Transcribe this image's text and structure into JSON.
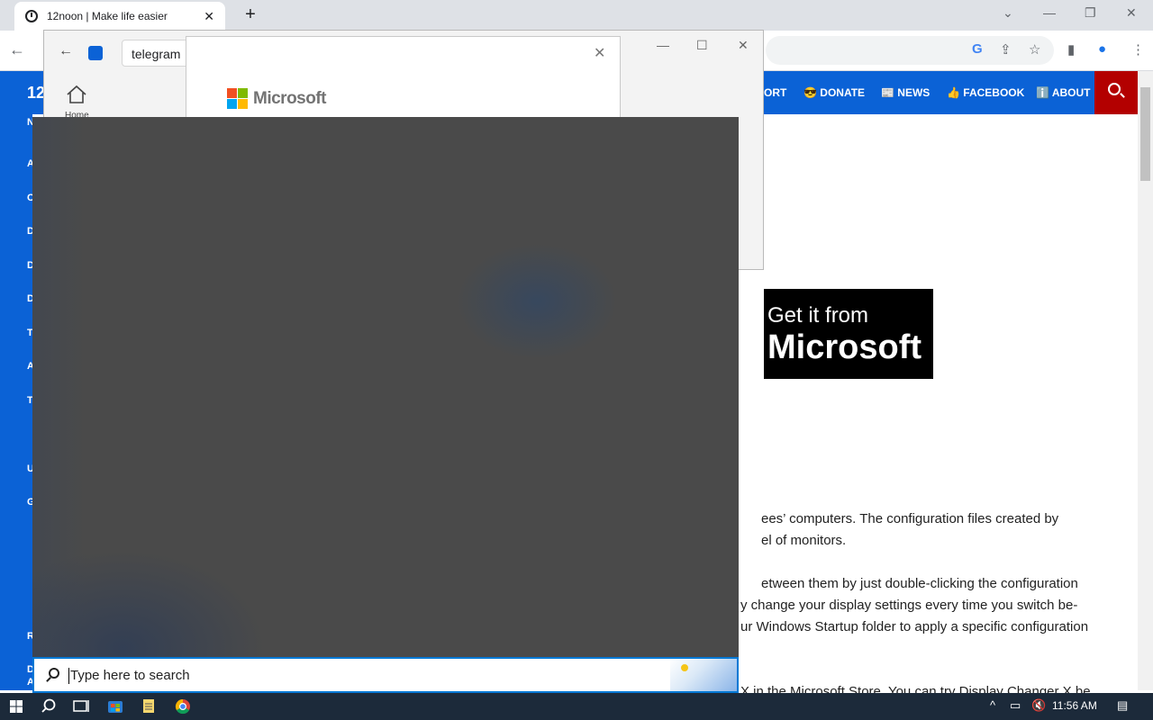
{
  "browser": {
    "tab_title": "12noon | Make life easier",
    "tab_close": "✕",
    "new_tab": "+",
    "back": "←",
    "minimize": "—",
    "restore": "❐",
    "close": "✕"
  },
  "site": {
    "logo": "12",
    "nav_items": [
      "ORT",
      "😎 DONATE",
      "📰 NEWS",
      "👍 FACEBOOK",
      "ℹ️ ABOUT"
    ],
    "sidebar_letters": [
      "N",
      "A",
      "C",
      "D",
      "D",
      "D",
      "T",
      "A",
      "T",
      "U",
      "G",
      "R",
      "D",
      "A"
    ],
    "badge_line1": "Get it from",
    "badge_line2": "Microsoft",
    "paragraphs": [
      "ees’ computers. The configuration files created by",
      "el of monitors.",
      "etween them by just double-clicking the configuration",
      "y change your display settings every time you switch be-",
      "ur Windows Startup folder to apply a specific configuration",
      "X in the Microsoft Store. You can try Display Changer X be"
    ]
  },
  "store": {
    "back": "←",
    "search_value": "telegram",
    "home_label": "Home",
    "minimize": "—",
    "maximize": "☐",
    "close": "✕"
  },
  "ms_dialog": {
    "brand": "Microsoft",
    "close": "✕"
  },
  "windows_search": {
    "placeholder": "Type here to search"
  },
  "taskbar": {
    "time": "11:56 AM",
    "tray_up": "^"
  },
  "colors": {
    "site_blue": "#0b62d6",
    "site_red": "#b30000",
    "ms_red": "#f25022",
    "ms_green": "#7fba00",
    "ms_blue": "#00a4ef",
    "ms_yellow": "#ffb900"
  }
}
